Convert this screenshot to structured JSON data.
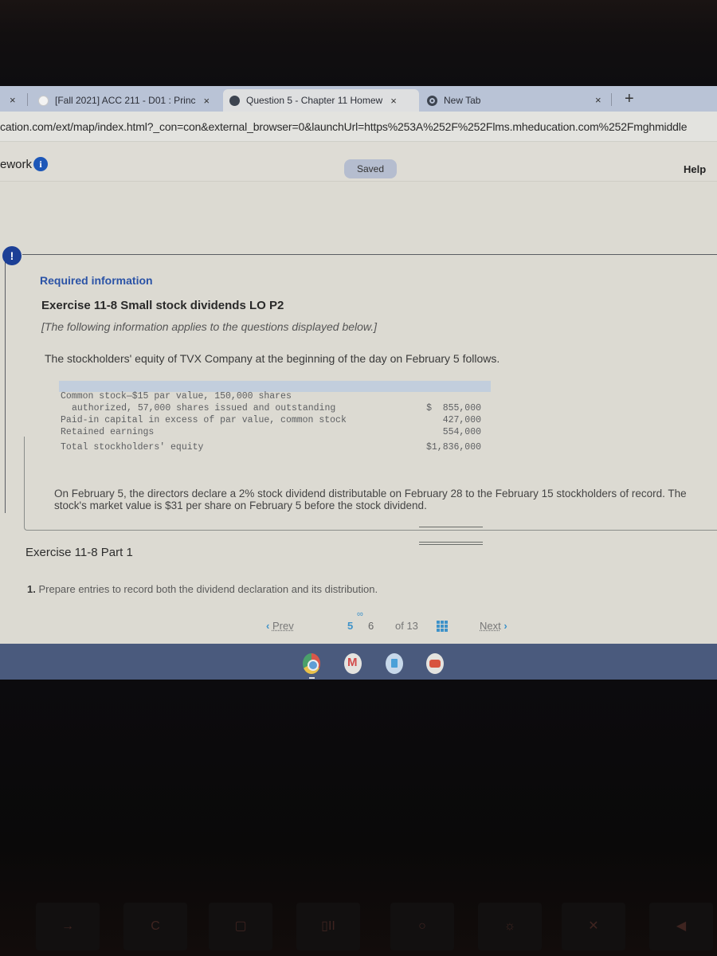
{
  "browser": {
    "tabs": [
      {
        "label": "[Fall 2021] ACC 211 - D01 : Princ",
        "icon": "d2l-icon",
        "active": false
      },
      {
        "label": "Question 5 - Chapter 11 Homew",
        "icon": "globe-icon",
        "active": true
      },
      {
        "label": "New Tab",
        "icon": "chrome-icon",
        "active": false
      }
    ],
    "close_glyph": "×",
    "new_tab_glyph": "+",
    "url": "cation.com/ext/map/index.html?_con=con&external_browser=0&launchUrl=https%253A%252F%252Flms.mheducation.com%252Fmghmiddle"
  },
  "app_header": {
    "title": "ework",
    "info_glyph": "i",
    "status": "Saved",
    "help": "Help"
  },
  "question": {
    "alert_glyph": "!",
    "required_label": "Required information",
    "exercise_title": "Exercise 11-8 Small stock dividends LO P2",
    "note": "[The following information applies to the questions displayed below.]",
    "intro": "The stockholders' equity of TVX Company at the beginning of the day on February 5 follows.",
    "equity_table": {
      "rows": [
        {
          "label": "Common stock—$15 par value, 150,000 shares",
          "currency": "",
          "value": ""
        },
        {
          "label": "authorized, 57,000 shares issued and outstanding",
          "currency": "$",
          "value": "855,000"
        },
        {
          "label": "Paid-in capital in excess of par value, common stock",
          "currency": "",
          "value": "427,000"
        },
        {
          "label": "Retained earnings",
          "currency": "",
          "value": "554,000"
        }
      ],
      "total": {
        "label": "Total stockholders' equity",
        "value": "$1,836,000"
      }
    },
    "dividend_info": "On February 5, the directors declare a 2% stock dividend distributable on February 28 to the February 15 stockholders of record. The stock's market value is $31 per share on February 5 before the stock dividend.",
    "part_title": "Exercise 11-8 Part 1",
    "prompt_number": "1.",
    "prompt": "Prepare entries to record both the dividend declaration and its distribution."
  },
  "pager": {
    "prev_glyph": "‹",
    "prev": "Prev",
    "link_glyph": "∞",
    "current": "5",
    "next_page": "6",
    "of": "of 13",
    "next": "Next",
    "next_glyph": "›"
  },
  "shelf": {
    "apps": [
      "chrome",
      "gmail",
      "files",
      "youtube"
    ],
    "gmail_glyph": "M"
  },
  "keyboard": {
    "keys": [
      "→",
      "C",
      "▢",
      "▯II",
      "○",
      "☼",
      "✕",
      "◀"
    ]
  }
}
